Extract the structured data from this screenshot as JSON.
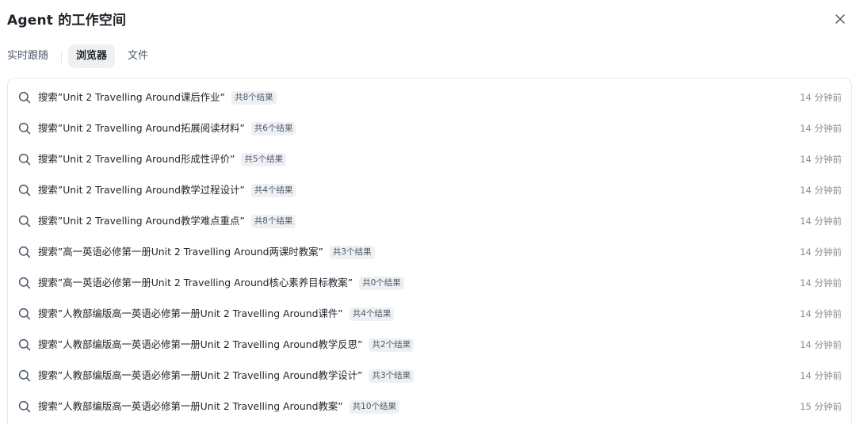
{
  "header": {
    "title": "Agent 的工作空间",
    "close_icon": "close-icon"
  },
  "tabs": [
    {
      "label": "实时跟随",
      "active": false
    },
    {
      "label": "浏览器",
      "active": true
    },
    {
      "label": "文件",
      "active": false
    }
  ],
  "results": [
    {
      "query": "搜索”Unit 2 Travelling Around课后作业”",
      "count": "共8个结果",
      "time": "14 分钟前",
      "icon": "search-icon"
    },
    {
      "query": "搜索”Unit 2 Travelling Around拓展阅读材料”",
      "count": "共6个结果",
      "time": "14 分钟前",
      "icon": "search-icon"
    },
    {
      "query": "搜索”Unit 2 Travelling Around形成性评价”",
      "count": "共5个结果",
      "time": "14 分钟前",
      "icon": "search-icon"
    },
    {
      "query": "搜索”Unit 2 Travelling Around教学过程设计”",
      "count": "共4个结果",
      "time": "14 分钟前",
      "icon": "search-icon"
    },
    {
      "query": "搜索”Unit 2 Travelling Around教学难点重点”",
      "count": "共8个结果",
      "time": "14 分钟前",
      "icon": "search-icon"
    },
    {
      "query": "搜索”高一英语必修第一册Unit 2 Travelling Around两课时教案”",
      "count": "共3个结果",
      "time": "14 分钟前",
      "icon": "search-icon"
    },
    {
      "query": "搜索”高一英语必修第一册Unit 2 Travelling Around核心素养目标教案”",
      "count": "共0个结果",
      "time": "14 分钟前",
      "icon": "search-icon"
    },
    {
      "query": "搜索”人教部编版高一英语必修第一册Unit 2 Travelling Around课件”",
      "count": "共4个结果",
      "time": "14 分钟前",
      "icon": "search-icon"
    },
    {
      "query": "搜索”人教部编版高一英语必修第一册Unit 2 Travelling Around教学反思”",
      "count": "共2个结果",
      "time": "14 分钟前",
      "icon": "search-icon"
    },
    {
      "query": "搜索”人教部编版高一英语必修第一册Unit 2 Travelling Around教学设计”",
      "count": "共3个结果",
      "time": "14 分钟前",
      "icon": "search-icon"
    },
    {
      "query": "搜索”人教部编版高一英语必修第一册Unit 2 Travelling Around教案”",
      "count": "共10个结果",
      "time": "15 分钟前",
      "icon": "search-icon"
    }
  ]
}
